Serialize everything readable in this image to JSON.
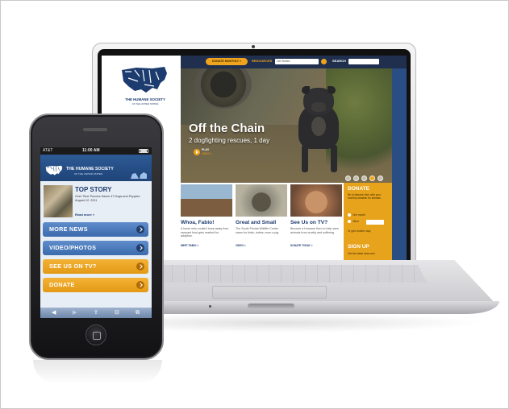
{
  "laptop_site": {
    "logo": {
      "name": "THE HUMANE SOCIETY",
      "sub": "OF THE UNITED STATES"
    },
    "nav": {
      "pill": "DONATE MONTHLY »",
      "link": "RESOURCES",
      "select_value": "Get Started",
      "search_label": "SEARCH"
    },
    "hero": {
      "title": "Off the Chain",
      "subtitle": "2 dogfighting rescues, 1 day",
      "play_label": "PLAY",
      "play_sub": "VIDEO »"
    },
    "stories": [
      {
        "title": "Whoa, Fabio!",
        "text": "A horse who couldn't keep away from rampant food gets readied for adoption.",
        "more": "MEET FABIO »"
      },
      {
        "title": "Great and Small",
        "text": "The South Florida Wildlife Center cares for birds, turtles, even a pig.",
        "more": "VIDEO »"
      },
      {
        "title": "See Us on TV?",
        "text": "Become a Humane Hero to help save animals from cruelty and suffering.",
        "more": "DONATE TODAY »"
      }
    ],
    "donate": {
      "title": "DONATE",
      "text": "Be a Humane Hero with your monthly donation for animals.",
      "opt1": "One month",
      "opt2": "Other",
      "opt3": "Or give another way",
      "signup_title": "SIGN UP",
      "signup_text": "Get the latest news and"
    }
  },
  "phone_site": {
    "status": {
      "carrier": "AT&T",
      "time": "11:00 AM"
    },
    "header": {
      "name": "THE HUMANE SOCIETY",
      "sub": "OF THE UNITED STATES"
    },
    "story": {
      "title": "TOP STORY",
      "text": "Over Time Puncha Saves 47 Dogs and Puppies",
      "date": "August 12, 2011",
      "more": "Read more »"
    },
    "buttons": [
      {
        "label": "MORE NEWS",
        "style": "blue"
      },
      {
        "label": "VIDEO/PHOTOS",
        "style": "blue"
      },
      {
        "label": "SEE US ON TV?",
        "style": "orange"
      },
      {
        "label": "DONATE",
        "style": "orange"
      }
    ],
    "toolbar": {
      "back": "◀",
      "forward": "▶",
      "share": "⇪",
      "bookmarks": "⊟",
      "tabs": "⧉"
    }
  },
  "colors": {
    "navy": "#1c3b6e",
    "blue": "#2a4d84",
    "orange": "#e8a31c",
    "phone_blue_btn": "#3b6bad"
  }
}
